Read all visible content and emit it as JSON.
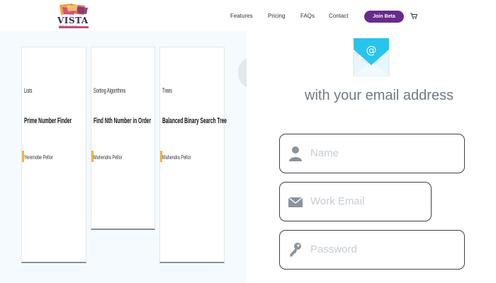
{
  "header": {
    "logo_text": "VISTA",
    "logo_sub": "WP PLUGIN",
    "nav": [
      "Features",
      "Pricing",
      "FAQs",
      "Contact"
    ],
    "cta_label": "Join Beta"
  },
  "cards": [
    {
      "category": "Lists",
      "title": "Prime Number Finder",
      "author": "Yeremobe Pellor"
    },
    {
      "category": "Sorting Algorithms",
      "title": "Find Nth Number in Order",
      "author": "Mahendra Pellor"
    },
    {
      "category": "Trees",
      "title": "Balanced Binary Search Tree",
      "author": "Mahendra Pellor"
    }
  ],
  "signup": {
    "headline": "with your email address",
    "fields": [
      {
        "placeholder": "Name",
        "icon": "user-icon"
      },
      {
        "placeholder": "Work Email",
        "icon": "envelope-icon"
      },
      {
        "placeholder": "Password",
        "icon": "key-icon"
      }
    ]
  },
  "colors": {
    "accent": "#6a2a8c",
    "mail_icon": "#29c4ec",
    "left_panel_bg": "#f4fafd",
    "field_border": "#3c4148",
    "author_marker": "#f5b23c"
  }
}
